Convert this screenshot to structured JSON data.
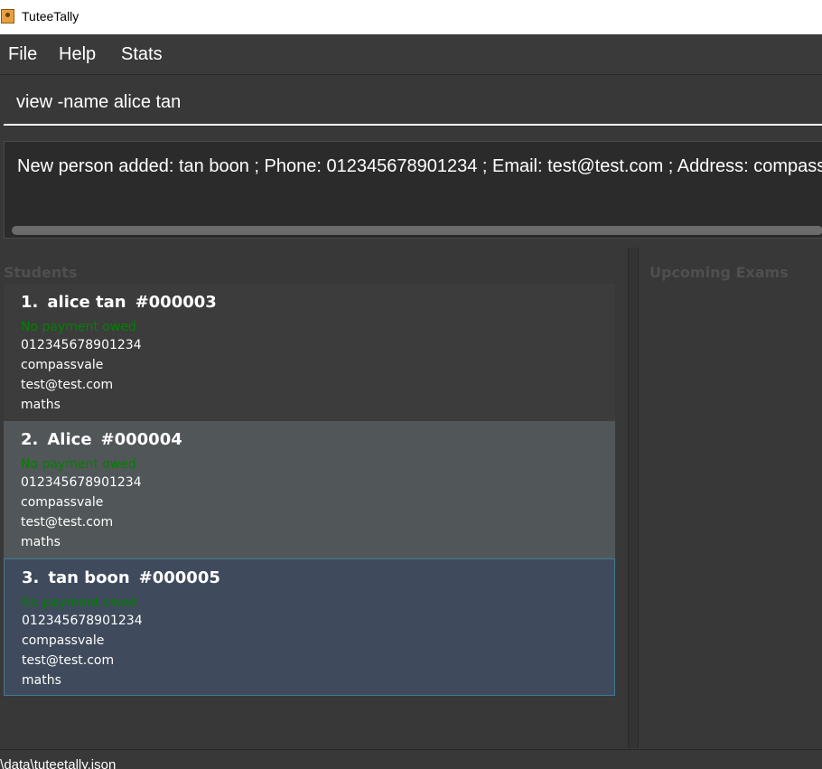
{
  "window": {
    "title": "TuteeTally",
    "icon": "app-icon"
  },
  "menu": {
    "items": [
      "File",
      "Help",
      "Stats"
    ]
  },
  "command": {
    "value": "view -name alice tan"
  },
  "result": {
    "text": "New person added: tan boon ; Phone: 012345678901234 ; Email: test@test.com ; Address: compassvale"
  },
  "students": {
    "title": "Students",
    "items": [
      {
        "index": "1.",
        "name": "alice tan",
        "id": "#000003",
        "payment": "No payment owed",
        "phone": "012345678901234",
        "address": "compassvale",
        "email": "test@test.com",
        "subject": "maths"
      },
      {
        "index": "2.",
        "name": "Alice",
        "id": "#000004",
        "payment": "No payment owed",
        "phone": "012345678901234",
        "address": "compassvale",
        "email": "test@test.com",
        "subject": "maths"
      },
      {
        "index": "3.",
        "name": "tan boon",
        "id": "#000005",
        "payment": "No payment owed",
        "phone": "012345678901234",
        "address": "compassvale",
        "email": "test@test.com",
        "subject": "maths"
      }
    ]
  },
  "exams": {
    "title": "Upcoming Exams"
  },
  "status": {
    "path": ".\\data\\tuteetally.json"
  },
  "colors": {
    "background": "#383838",
    "payment_ok": "#008000",
    "selected_border": "#3e7b91"
  }
}
